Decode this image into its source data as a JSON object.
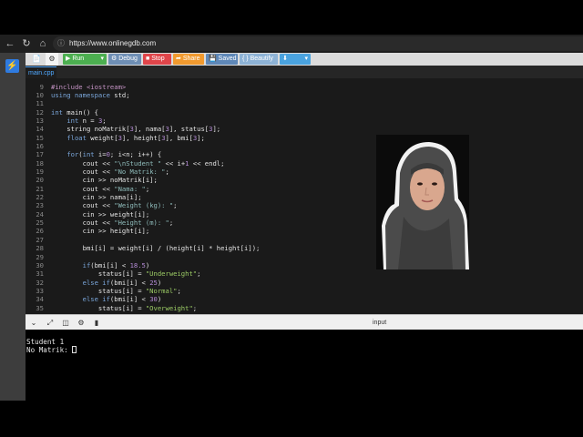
{
  "browser": {
    "url": "https://www.onlinegdb.com",
    "icons": [
      "back-icon",
      "reload-icon",
      "home-icon",
      "site-info-icon"
    ]
  },
  "toolbar": {
    "run_label": "Run",
    "debug_label": "Debug",
    "stop_label": "Stop",
    "share_label": "Share",
    "saved_label": "Saved",
    "beautify_label": "{ } Beautify",
    "colors": {
      "run": "#4caf50",
      "debug": "#6f8fb5",
      "stop": "#e0454a",
      "share": "#f19a2f",
      "saved": "#5f88b8",
      "beautify": "#8eb3d6",
      "download": "#4aa3df"
    }
  },
  "tab": {
    "filename": "main.cpp"
  },
  "editor": {
    "lines": [
      {
        "n": "9",
        "html": "<span class='pp'>#include &lt;iostream&gt;</span>"
      },
      {
        "n": "10",
        "html": "<span class='kw'>using namespace</span> std;"
      },
      {
        "n": "11",
        "html": ""
      },
      {
        "n": "12",
        "html": "<span class='kw'>int</span> main() {"
      },
      {
        "n": "13",
        "html": "    <span class='kw'>int</span> n = <span class='num'>3</span>;"
      },
      {
        "n": "14",
        "html": "    string noMatrik[<span class='num'>3</span>], nama[<span class='num'>3</span>], status[<span class='num'>3</span>];"
      },
      {
        "n": "15",
        "html": "    <span class='kw'>float</span> weight[<span class='num'>3</span>], height[<span class='num'>3</span>], bmi[<span class='num'>3</span>];"
      },
      {
        "n": "16",
        "html": ""
      },
      {
        "n": "17",
        "html": "    <span class='kw'>for</span>(<span class='kw'>int</span> i=<span class='num'>0</span>; i&lt;n; i++) {"
      },
      {
        "n": "18",
        "html": "        cout &lt;&lt; <span class='str'>\"\\nStudent \"</span> &lt;&lt; i+<span class='num'>1</span> &lt;&lt; endl;"
      },
      {
        "n": "19",
        "html": "        cout &lt;&lt; <span class='str'>\"No Matrik: \"</span>;"
      },
      {
        "n": "20",
        "html": "        cin &gt;&gt; noMatrik[i];"
      },
      {
        "n": "21",
        "html": "        cout &lt;&lt; <span class='str'>\"Nama: \"</span>;"
      },
      {
        "n": "22",
        "html": "        cin &gt;&gt; nama[i];"
      },
      {
        "n": "23",
        "html": "        cout &lt;&lt; <span class='str'>\"Weight (kg): \"</span>;"
      },
      {
        "n": "24",
        "html": "        cin &gt;&gt; weight[i];"
      },
      {
        "n": "25",
        "html": "        cout &lt;&lt; <span class='str'>\"Height (m): \"</span>;"
      },
      {
        "n": "26",
        "html": "        cin &gt;&gt; height[i];"
      },
      {
        "n": "27",
        "html": ""
      },
      {
        "n": "28",
        "html": "        bmi[i] = weight[i] / (height[i] * height[i]);"
      },
      {
        "n": "29",
        "html": ""
      },
      {
        "n": "30",
        "html": "        <span class='kw'>if</span>(bmi[i] &lt; <span class='num'>18.5</span>)"
      },
      {
        "n": "31",
        "html": "            status[i] = <span class='grn'>\"Underweight\"</span>;"
      },
      {
        "n": "32",
        "html": "        <span class='kw'>else if</span>(bmi[i] &lt; <span class='num'>25</span>)"
      },
      {
        "n": "33",
        "html": "            status[i] = <span class='grn'>\"Normal\"</span>;"
      },
      {
        "n": "34",
        "html": "        <span class='kw'>else if</span>(bmi[i] &lt; <span class='num'>30</span>)"
      },
      {
        "n": "35",
        "html": "            status[i] = <span class='grn'>\"Overweight\"</span>;"
      }
    ]
  },
  "io": {
    "label": "input",
    "icons": [
      "chevron-down-icon",
      "expand-icon",
      "split-icon",
      "settings-icon",
      "dock-icon"
    ]
  },
  "console": {
    "lines": [
      "Student 1",
      "No Matrik: "
    ]
  }
}
